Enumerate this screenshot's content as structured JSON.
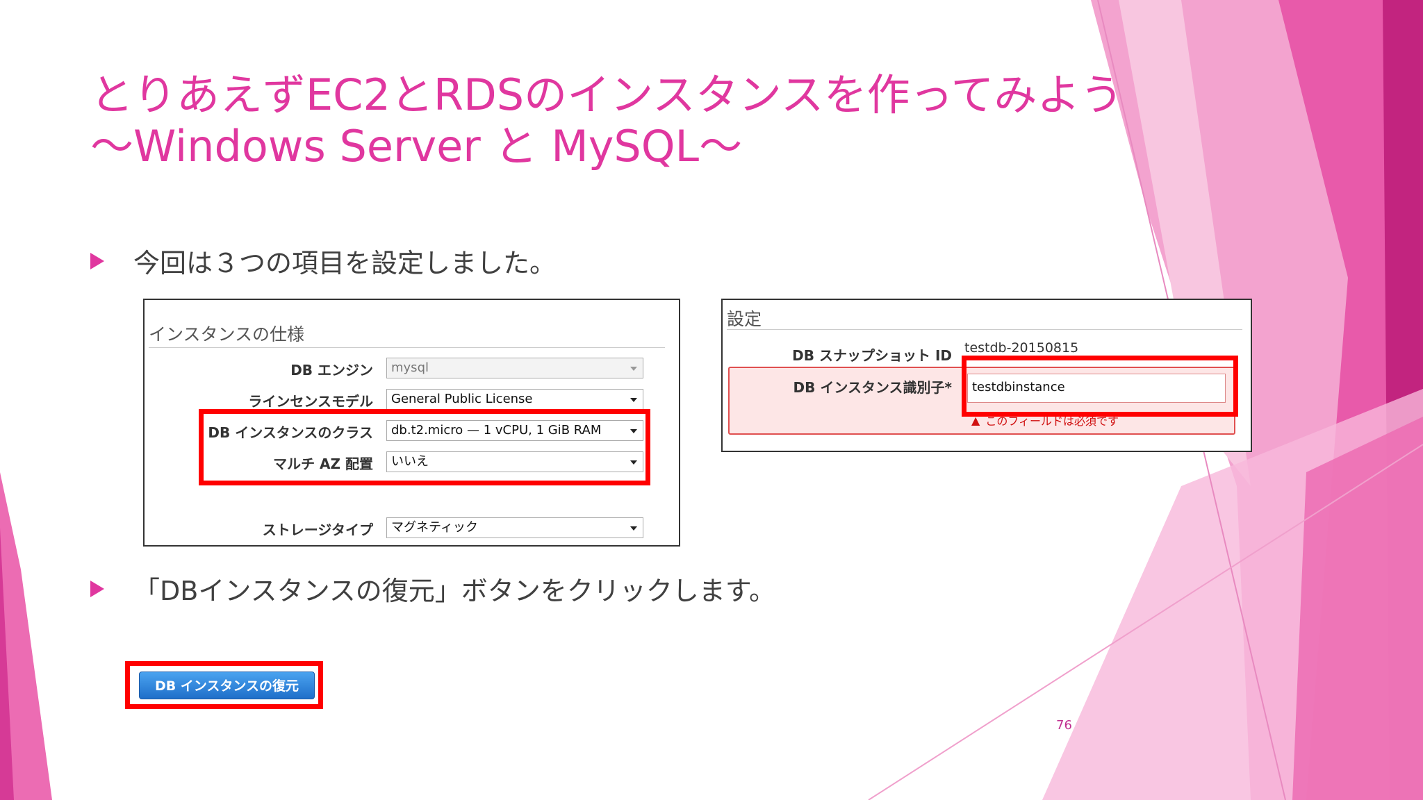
{
  "slide": {
    "title_line1": "とりあえずEC2とRDSのインスタンスを作ってみよう",
    "title_line2": "～Windows Server と MySQL～",
    "bullets": [
      "今回は３つの項目を設定しました。",
      "「DBインスタンスの復元」ボタンをクリックします。"
    ],
    "page_number": "76",
    "accent_color": "#e0379f"
  },
  "panel1": {
    "header": "インスタンスの仕様",
    "rows": [
      {
        "label": "DB エンジン",
        "value": "mysql"
      },
      {
        "label": "ラインセンスモデル",
        "value": "General Public License"
      },
      {
        "label": "DB インスタンスのクラス",
        "value": "db.t2.micro — 1 vCPU, 1 GiB RAM"
      },
      {
        "label": "マルチ AZ 配置",
        "value": "いいえ"
      },
      {
        "label": "ストレージタイプ",
        "value": "マグネティック"
      }
    ]
  },
  "panel2": {
    "header": "設定",
    "snapshot_label": "DB スナップショット ID",
    "snapshot_value": "testdb-20150815",
    "identifier_label": "DB インスタンス識別子*",
    "identifier_value": "testdbinstance",
    "error_message": "このフィールドは必須です"
  },
  "restore_button": {
    "label": "DB インスタンスの復元"
  }
}
